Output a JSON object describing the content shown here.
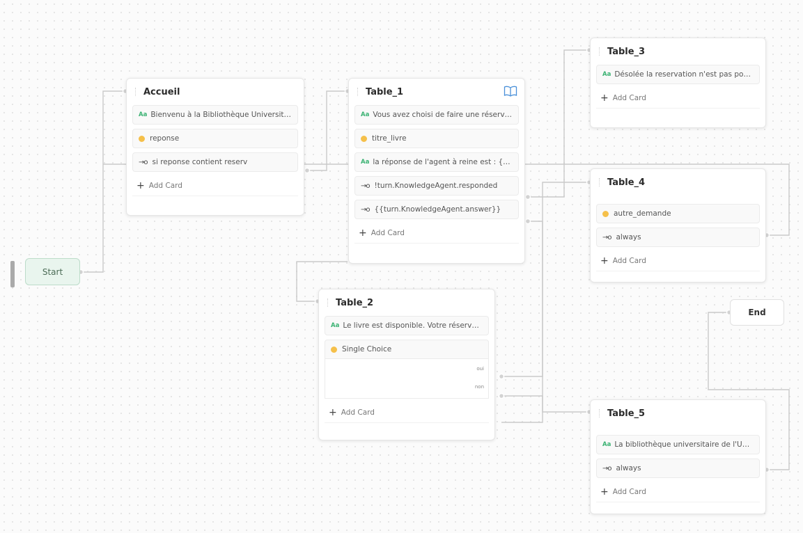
{
  "colors": {
    "text_icon": "#3bb273",
    "capture_icon": "#f5c04a",
    "start_bg": "#e9f5ee",
    "edge": "#c9c9c9"
  },
  "icons": {
    "text": "text-icon",
    "capture": "capture-icon",
    "condition": "condition-icon",
    "add": "plus-icon",
    "knowledge": "book-icon"
  },
  "start": {
    "label": "Start"
  },
  "end": {
    "label": "End"
  },
  "add_card_label": "Add Card",
  "nodes": {
    "accueil": {
      "title": "Accueil",
      "cards": [
        {
          "type": "text",
          "label": "Bienvenu à la Bibliothèque Universitaire"
        },
        {
          "type": "capture",
          "label": "reponse"
        },
        {
          "type": "condition",
          "label": "si reponse contient reserv"
        }
      ]
    },
    "table_1": {
      "title": "Table_1",
      "cards": [
        {
          "type": "text",
          "label": "Vous avez choisi de faire une réservation"
        },
        {
          "type": "capture",
          "label": "titre_livre"
        },
        {
          "type": "text",
          "label": "la réponse de l'agent à reine est : {{turn.KnowledgeAgent.answer}}"
        },
        {
          "type": "condition",
          "label": "!turn.KnowledgeAgent.responded"
        },
        {
          "type": "condition",
          "label": "{{turn.KnowledgeAgent.answer}}"
        }
      ]
    },
    "table_2": {
      "title": "Table_2",
      "cards": [
        {
          "type": "text",
          "label": "Le livre est disponible. Votre réservation"
        },
        {
          "type": "capture",
          "label": "Single Choice"
        }
      ],
      "choices": [
        "oui",
        "non"
      ]
    },
    "table_3": {
      "title": "Table_3",
      "cards": [
        {
          "type": "text",
          "label": "Désolée la reservation n'est pas possible"
        }
      ]
    },
    "table_4": {
      "title": "Table_4",
      "cards": [
        {
          "type": "capture",
          "label": "autre_demande"
        },
        {
          "type": "condition",
          "label": "always"
        }
      ]
    },
    "table_5": {
      "title": "Table_5",
      "cards": [
        {
          "type": "text",
          "label": "La bibliothèque universitaire de l'Université"
        },
        {
          "type": "condition",
          "label": "always"
        }
      ]
    }
  }
}
